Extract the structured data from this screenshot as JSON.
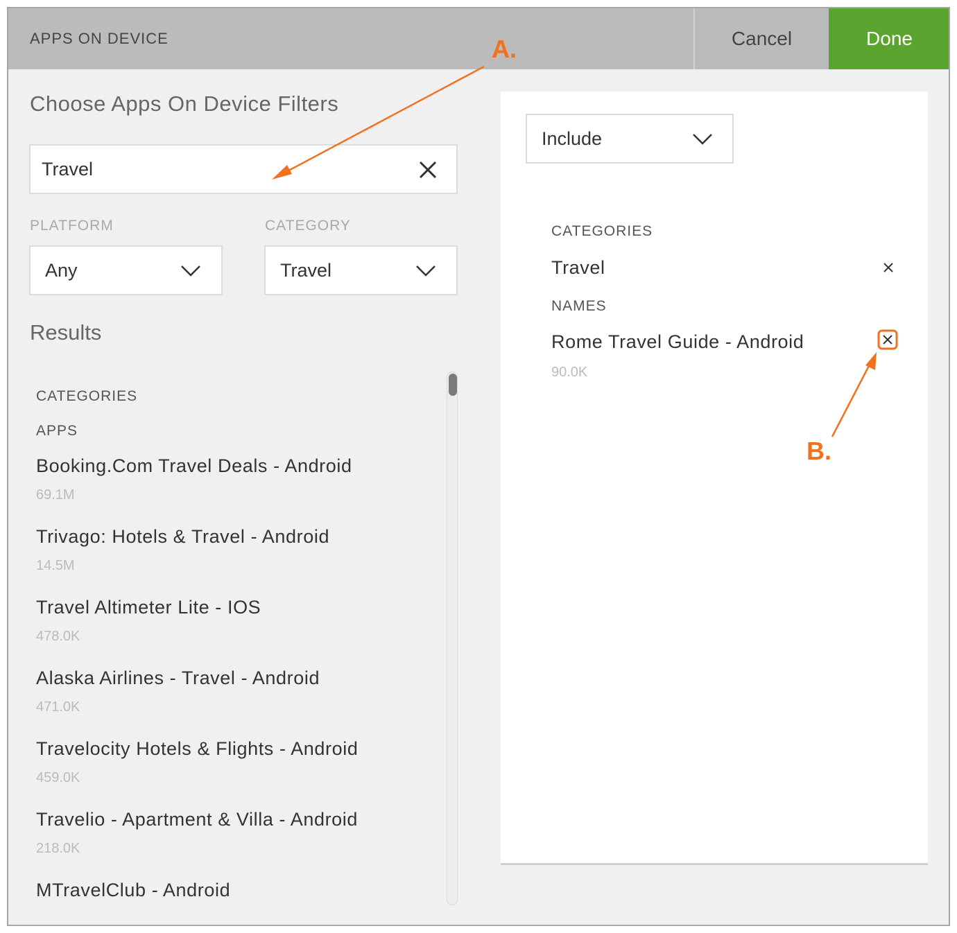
{
  "header": {
    "title": "APPS ON DEVICE",
    "cancel_label": "Cancel",
    "done_label": "Done",
    "done_color": "#5aa42f"
  },
  "filters": {
    "title": "Choose Apps On Device Filters",
    "search_value": "Travel",
    "platform_label": "PLATFORM",
    "platform_value": "Any",
    "category_label": "CATEGORY",
    "category_value": "Travel"
  },
  "results": {
    "title": "Results",
    "categories_header": "CATEGORIES",
    "apps_header": "APPS",
    "apps": [
      {
        "name": "Booking.Com Travel Deals - Android",
        "count": "69.1M"
      },
      {
        "name": "Trivago: Hotels & Travel - Android",
        "count": "14.5M"
      },
      {
        "name": "Travel Altimeter Lite - IOS",
        "count": "478.0K"
      },
      {
        "name": "Alaska Airlines - Travel - Android",
        "count": "471.0K"
      },
      {
        "name": "Travelocity Hotels & Flights - Android",
        "count": "459.0K"
      },
      {
        "name": "Travelio - Apartment & Villa - Android",
        "count": "218.0K"
      },
      {
        "name": "MTravelClub - Android",
        "count": ""
      }
    ]
  },
  "selection": {
    "mode_value": "Include",
    "categories_header": "CATEGORIES",
    "category_item": "Travel",
    "names_header": "NAMES",
    "name_item": "Rome Travel Guide - Android",
    "name_count": "90.0K"
  },
  "annotations": {
    "a_label": "A.",
    "b_label": "B.",
    "color": "#f0711e"
  }
}
